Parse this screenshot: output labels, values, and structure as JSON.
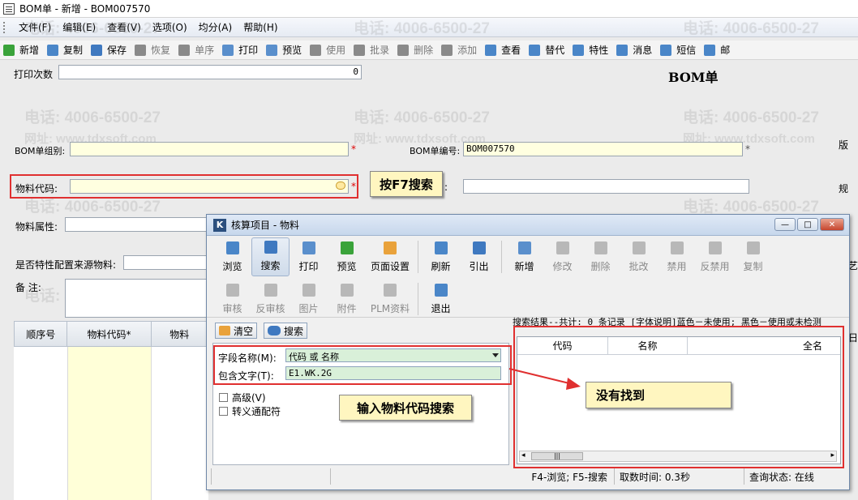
{
  "window": {
    "title": "BOM单 - 新增 - BOM007570"
  },
  "menu": [
    "文件(F)",
    "编辑(E)",
    "查看(V)",
    "选项(O)",
    "均分(A)",
    "帮助(H)"
  ],
  "toolbar": [
    {
      "label": "新增",
      "icon": "add-icon",
      "color": "#3aa33a",
      "enabled": true
    },
    {
      "label": "复制",
      "icon": "copy-icon",
      "color": "#4a86c8",
      "enabled": true
    },
    {
      "label": "保存",
      "icon": "save-icon",
      "color": "#3f79c0",
      "enabled": true
    },
    {
      "label": "恢复",
      "icon": "undo-icon",
      "color": "#8a8a8a",
      "enabled": false
    },
    {
      "label": "单序",
      "icon": "sort-icon",
      "color": "#8a8a8a",
      "enabled": false
    },
    {
      "label": "打印",
      "icon": "print-icon",
      "color": "#5a8fcc",
      "enabled": true
    },
    {
      "label": "预览",
      "icon": "preview-icon",
      "color": "#5a8fcc",
      "enabled": true
    },
    {
      "label": "使用",
      "icon": "use-icon",
      "color": "#8a8a8a",
      "enabled": false
    },
    {
      "label": "批录",
      "icon": "batch-icon",
      "color": "#8a8a8a",
      "enabled": false
    },
    {
      "label": "删除",
      "icon": "delete-icon",
      "color": "#8a8a8a",
      "enabled": false
    },
    {
      "label": "添加",
      "icon": "append-icon",
      "color": "#8a8a8a",
      "enabled": false
    },
    {
      "label": "查看",
      "icon": "view-icon",
      "color": "#4a86c8",
      "enabled": true
    },
    {
      "label": "替代",
      "icon": "replace-icon",
      "color": "#4a86c8",
      "enabled": true
    },
    {
      "label": "特性",
      "icon": "feature-icon",
      "color": "#4a86c8",
      "enabled": true
    },
    {
      "label": "消息",
      "icon": "message-icon",
      "color": "#4a86c8",
      "enabled": true
    },
    {
      "label": "短信",
      "icon": "sms-icon",
      "color": "#4a86c8",
      "enabled": true
    },
    {
      "label": "邮",
      "icon": "mail-icon",
      "color": "#4a86c8",
      "enabled": true
    }
  ],
  "form": {
    "print_count_label": "打印次数",
    "print_count_value": "0",
    "bom_title": "BOM单",
    "bom_group_label": "BOM单组别:",
    "bom_number_label": "BOM单编号:",
    "bom_number_value": "BOM007570",
    "version_label": "版",
    "material_code_label": "物料代码:",
    "material_name_label_frag": ":",
    "spec_label": "规",
    "material_attr_label": "物料属性:",
    "config_source_label": "是否特性配置来源物料:",
    "remark_label": "备  注:",
    "right_edge_label": "艺",
    "grid_columns": [
      "顺序号",
      "物料代码*",
      "物料"
    ],
    "right_edge_grid": "日"
  },
  "annotations": {
    "f7_hint": "按F7搜索",
    "input_hint": "输入物料代码搜索",
    "not_found": "没有找到"
  },
  "watermark": {
    "phone": "电话: 4006-6500-27",
    "site": "网址: www.tdxsoft.com"
  },
  "dialog": {
    "title": "核算项目 - 物料",
    "tools_row1": [
      {
        "label": "浏览",
        "icon": "browse-icon",
        "enabled": true
      },
      {
        "label": "搜索",
        "icon": "search-icon",
        "enabled": true,
        "selected": true
      },
      {
        "label": "打印",
        "icon": "print-icon",
        "enabled": true
      },
      {
        "label": "预览",
        "icon": "preview-icon",
        "enabled": true
      },
      {
        "label": "页面设置",
        "icon": "page-setup-icon",
        "enabled": true
      },
      {
        "label": "刷新",
        "icon": "refresh-icon",
        "enabled": true
      },
      {
        "label": "引出",
        "icon": "export-icon",
        "enabled": true
      },
      {
        "label": "新增",
        "icon": "add-icon",
        "enabled": true
      },
      {
        "label": "修改",
        "icon": "edit-icon",
        "enabled": false
      },
      {
        "label": "删除",
        "icon": "delete-icon",
        "enabled": false
      },
      {
        "label": "批改",
        "icon": "batch-edit-icon",
        "enabled": false
      },
      {
        "label": "禁用",
        "icon": "disable-icon",
        "enabled": false
      },
      {
        "label": "反禁用",
        "icon": "enable-icon",
        "enabled": false
      },
      {
        "label": "复制",
        "icon": "copy-icon",
        "enabled": false
      }
    ],
    "tools_row2": [
      {
        "label": "审核",
        "icon": "approve-icon",
        "enabled": false
      },
      {
        "label": "反审核",
        "icon": "unapprove-icon",
        "enabled": false
      },
      {
        "label": "图片",
        "icon": "picture-icon",
        "enabled": false
      },
      {
        "label": "附件",
        "icon": "attachment-icon",
        "enabled": false
      },
      {
        "label": "PLM资料",
        "icon": "plm-icon",
        "enabled": false
      },
      {
        "label": "退出",
        "icon": "exit-icon",
        "enabled": true
      }
    ],
    "clear_label": "清空",
    "search_label": "搜索",
    "field_name_label": "字段名称(M):",
    "field_name_value": "代码 或 名称",
    "contains_label": "包含文字(T):",
    "contains_value": "E1.WK.2G",
    "advanced_label": "高级(V)",
    "wildcard_label": "转义通配符",
    "result_status": "搜索结果--共计: 0 条记录 [字体说明]蓝色－未使用; 黑色－使用或未检测",
    "result_columns": [
      "代码",
      "名称",
      "全名"
    ],
    "status_bar": [
      "F4-浏览; F5-搜索",
      "取数时间: 0.3秒",
      "查询状态: 在线"
    ]
  },
  "colors": {
    "required": "#dd0000",
    "highlight": "#e03030",
    "callout_bg": "#fff6c0",
    "yellow_field": "#ffffe0"
  }
}
